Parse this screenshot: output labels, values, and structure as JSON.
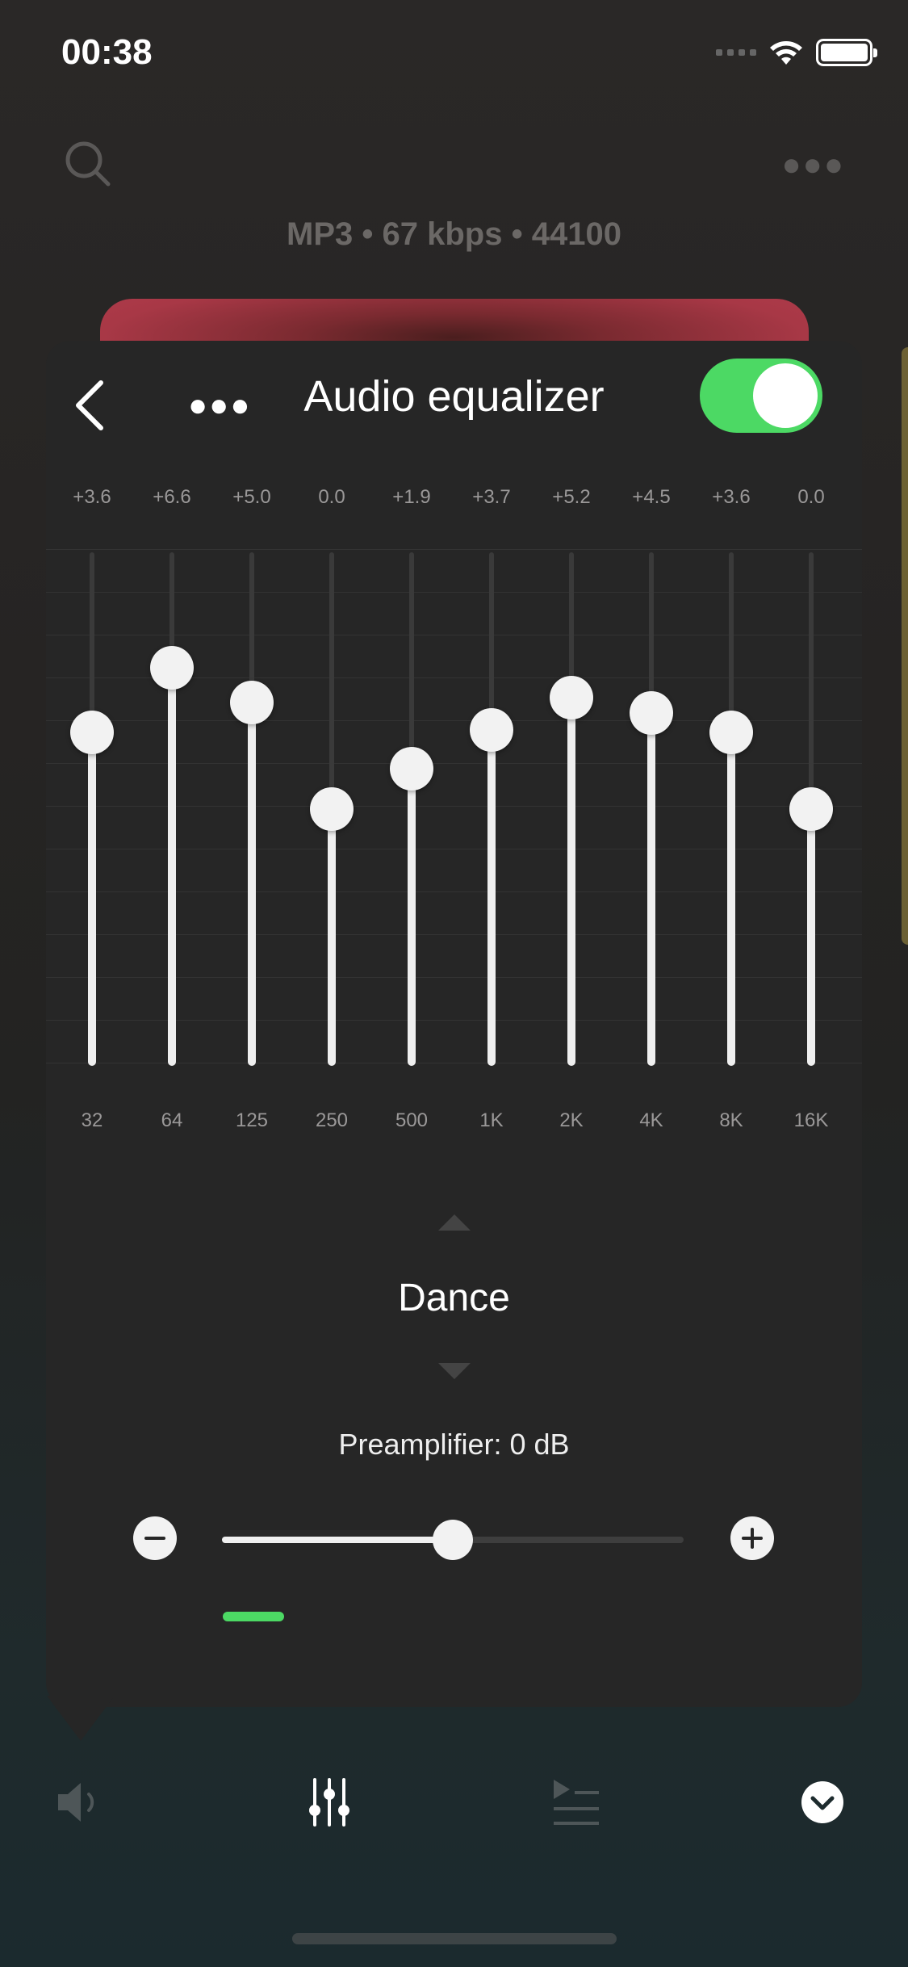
{
  "status_bar": {
    "time": "00:38"
  },
  "background": {
    "track_info": "MP3 • 67 kbps • 44100",
    "icons": [
      "search-icon",
      "more-icon"
    ]
  },
  "equalizer": {
    "title": "Audio equalizer",
    "enabled": true,
    "accent_color": "#4cd964",
    "range_db": [
      -12,
      12
    ],
    "bands": [
      {
        "freq": "32",
        "gain_label": "+3.6",
        "gain": 3.6
      },
      {
        "freq": "64",
        "gain_label": "+6.6",
        "gain": 6.6
      },
      {
        "freq": "125",
        "gain_label": "+5.0",
        "gain": 5.0
      },
      {
        "freq": "250",
        "gain_label": "0.0",
        "gain": 0.0
      },
      {
        "freq": "500",
        "gain_label": "+1.9",
        "gain": 1.9
      },
      {
        "freq": "1K",
        "gain_label": "+3.7",
        "gain": 3.7
      },
      {
        "freq": "2K",
        "gain_label": "+5.2",
        "gain": 5.2
      },
      {
        "freq": "4K",
        "gain_label": "+4.5",
        "gain": 4.5
      },
      {
        "freq": "8K",
        "gain_label": "+3.6",
        "gain": 3.6
      },
      {
        "freq": "16K",
        "gain_label": "0.0",
        "gain": 0.0
      }
    ],
    "preset": "Dance",
    "preamp_label": "Preamplifier: 0 dB",
    "preamp_level_fraction": 0.5
  },
  "toolbar": {
    "icons": [
      "volume-icon",
      "equalizer-icon",
      "queue-icon",
      "chevron-down-icon"
    ],
    "active": "equalizer-icon"
  }
}
